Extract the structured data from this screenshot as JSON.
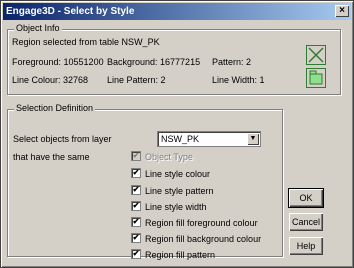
{
  "window": {
    "title": "Engage3D - Select by Style",
    "close_label": "×"
  },
  "object_info": {
    "group_label": "Object Info",
    "region_line": "Region selected from table NSW_PK",
    "foreground": "Foreground: 10551200",
    "background": "Background: 16777215",
    "pattern": "Pattern: 2",
    "line_colour": "Line Colour: 32768",
    "line_pattern": "Line Pattern: 2",
    "line_width": "Line Width: 1",
    "colors": {
      "line_icon": "#2e7d32",
      "region_icon_fill": "#c8ecc8"
    }
  },
  "selection": {
    "group_label": "Selection Definition",
    "layer_label": "Select objects from layer",
    "layer_value": "NSW_PK",
    "same_label": "that have the same",
    "options": [
      {
        "label": "Object Type",
        "checked": true,
        "disabled": true
      },
      {
        "label": "Line style colour",
        "checked": true,
        "disabled": false
      },
      {
        "label": "Line style pattern",
        "checked": true,
        "disabled": false
      },
      {
        "label": "Line style width",
        "checked": true,
        "disabled": false
      },
      {
        "label": "Region fill foreground colour",
        "checked": true,
        "disabled": false
      },
      {
        "label": "Region fill background colour",
        "checked": true,
        "disabled": false
      },
      {
        "label": "Region fill pattern",
        "checked": true,
        "disabled": false
      }
    ]
  },
  "buttons": {
    "ok": "OK",
    "cancel": "Cancel",
    "help": "Help"
  },
  "check_glyph": "✔"
}
